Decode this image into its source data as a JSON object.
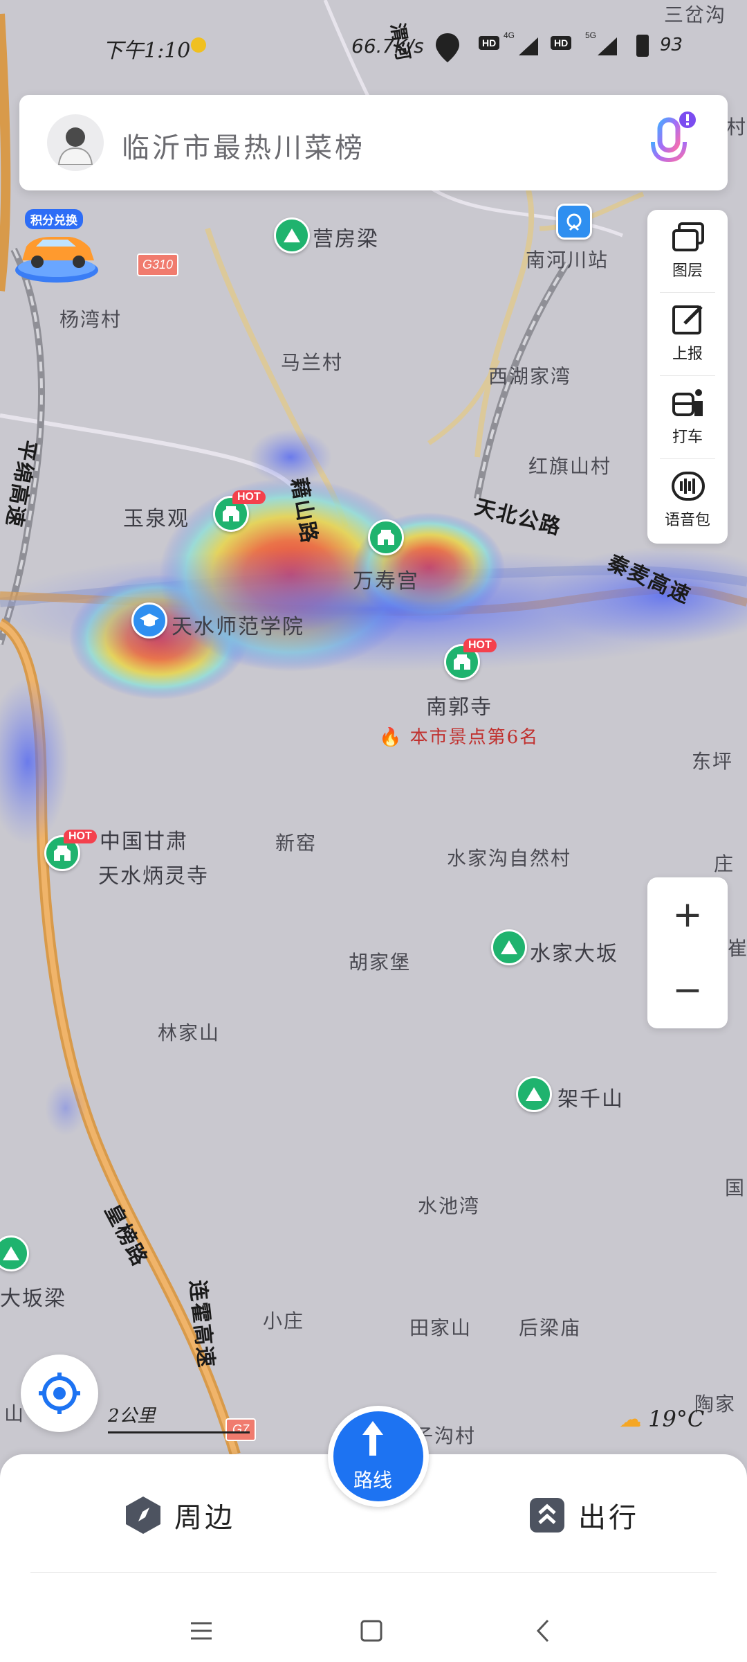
{
  "status_bar": {
    "time": "下午1:10",
    "network_speed": "66.7K/s",
    "sim1": "4G",
    "sim2": "5G",
    "hd1": "HD",
    "hd2": "HD",
    "battery": "93"
  },
  "search": {
    "placeholder": "临沂市最热川菜榜"
  },
  "promo": {
    "label": "积分兑换"
  },
  "tools": [
    {
      "label": "图层",
      "icon": "layers-icon"
    },
    {
      "label": "上报",
      "icon": "report-edit-icon"
    },
    {
      "label": "打车",
      "icon": "taxi-icon"
    },
    {
      "label": "语音包",
      "icon": "voice-pack-icon"
    }
  ],
  "map": {
    "road_shield_top": "G310",
    "road_shield_bottom": "G7",
    "hot_badge": "HOT",
    "places": {
      "yingfangliang": "营房梁",
      "nanhechuan": "南河川站",
      "yangjiacun": "杨湾村",
      "malancun": "马兰村",
      "xihujiawan": "西湖家湾",
      "hongqishan": "红旗山村",
      "yuquanguan": "玉泉观",
      "wanshougong": "万寿宫",
      "shifan": "天水师范学院",
      "nanguosi": "南郭寺",
      "ranking": "本市景点第6名",
      "dongping": "东坪",
      "bingling_1": "中国甘肃",
      "bingling_2": "天水炳灵寺",
      "xinyao": "新窑",
      "shuijiagou": "水家沟自然村",
      "zhuang": "庄",
      "hujiabao": "胡家堡",
      "shuijiadaban": "水家大坂",
      "linjiashan": "林家山",
      "jiaqianshan": "架千山",
      "shuichiwan": "水池湾",
      "dabanliang": "大坂梁",
      "xiaozhuang": "小庄",
      "tianjiashan": "田家山",
      "houliangmiao": "后梁庙",
      "taojia": "陶家",
      "anzigou": "鞍子沟村",
      "shan": "山",
      "guo": "国",
      "sancha": "三岔沟",
      "cun": "村",
      "cui": "崔"
    },
    "roads": {
      "tianbei": "天北公路",
      "qinmai": "秦麦高速",
      "huangbang": "皇榜路",
      "lianhuo": "连霍高速",
      "pingmian": "平绵高速",
      "ruishan": "藉山路",
      "weihe": "渭河"
    }
  },
  "scale_bar": "2公里",
  "weather": "19°C",
  "bottom_bar": {
    "nearby": "周边",
    "route": "路线",
    "travel": "出行"
  },
  "colors": {
    "accent_blue": "#1d73f2",
    "poi_green": "#1fb36e",
    "hot_red": "#f4414d"
  }
}
